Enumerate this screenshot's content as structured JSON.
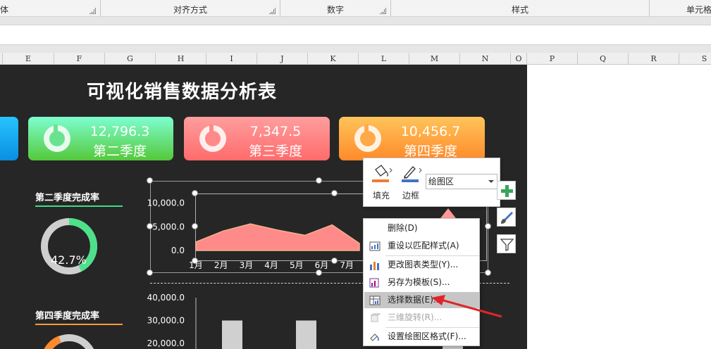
{
  "ribbon": {
    "groups": [
      {
        "label": "体",
        "launcher": true
      },
      {
        "label": "对齐方式",
        "launcher": true
      },
      {
        "label": "数字",
        "launcher": true
      },
      {
        "label": "样式",
        "launcher": false
      },
      {
        "label": "单元格",
        "launcher": false
      }
    ]
  },
  "sheet": {
    "columns": [
      "E",
      "F",
      "G",
      "H",
      "I",
      "J",
      "K",
      "L",
      "M",
      "N",
      "O",
      "P",
      "Q",
      "R",
      "S"
    ]
  },
  "dashboard": {
    "title": "可视化销售数据分析表",
    "cards": [
      {
        "value": "12,796.3",
        "label": "第二季度"
      },
      {
        "value": "7,347.5",
        "label": "第三季度"
      },
      {
        "value": "10,456.7",
        "label": "第四季度"
      }
    ],
    "q2_rate": {
      "title": "第二季度完成率",
      "value": "42.7%",
      "fraction": 0.427
    },
    "q4_rate": {
      "title": "第四季度完成率"
    }
  },
  "chart_data": [
    {
      "type": "area",
      "categories": [
        "1月",
        "2月",
        "3月",
        "4月",
        "5月",
        "6月",
        "7月"
      ],
      "values": [
        1800,
        4100,
        5600,
        4300,
        3200,
        5400,
        1500
      ],
      "y_ticks": [
        "10,000.0",
        "5,000.0",
        "0.0"
      ],
      "ylim": [
        0,
        12000
      ],
      "color": "#ff8a8a"
    },
    {
      "type": "bar",
      "y_ticks": [
        "40,000.0",
        "30,000.0",
        "20,000.0"
      ],
      "ylim": [
        0,
        45000
      ],
      "color": "#d0d0d0"
    }
  ],
  "mini_toolbar": {
    "fill_label": "填充",
    "border_label": "边框",
    "selection": "绘图区"
  },
  "context_menu": {
    "items": [
      {
        "label": "删除(D)",
        "icon": "delete-icon"
      },
      {
        "label": "重设以匹配样式(A)",
        "icon": "reset-style-icon"
      },
      {
        "label": "更改图表类型(Y)...",
        "icon": "chart-type-icon"
      },
      {
        "label": "另存为模板(S)...",
        "icon": "save-template-icon"
      },
      {
        "label": "选择数据(E)...",
        "icon": "select-data-icon"
      },
      {
        "label": "三维旋转(R)...",
        "icon": "3d-rotate-icon"
      },
      {
        "label": "设置绘图区格式(F)...",
        "icon": "format-plot-area-icon"
      }
    ]
  },
  "colors": {
    "dashboard_bg": "#262626",
    "card_q2": "#5fd46a",
    "card_q3": "#ff7f7f",
    "card_q4": "#ff9a3c",
    "arrow": "#e0242a"
  }
}
